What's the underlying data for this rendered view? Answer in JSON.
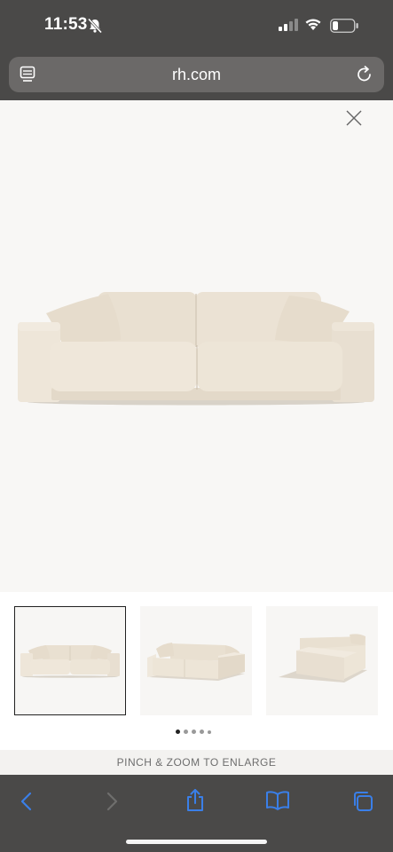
{
  "status_bar": {
    "time": "11:53"
  },
  "browser": {
    "url": "rh.com"
  },
  "gallery": {
    "thumbnails": [
      {
        "view": "front",
        "selected": true
      },
      {
        "view": "angled",
        "selected": false
      },
      {
        "view": "side",
        "selected": false
      }
    ],
    "dot_count": 5,
    "active_dot": 1,
    "hint": "PINCH & ZOOM TO ENLARGE"
  },
  "colors": {
    "chrome": "#4a4948",
    "url_bar": "#6b6968",
    "sofa": "#ede4d6",
    "toolbar_icons": "#3a7fe8"
  },
  "icons": {
    "status": [
      "bell-slash-icon",
      "cellular-signal-icon",
      "wifi-icon",
      "battery-icon"
    ],
    "url_bar": [
      "tabs-overview-icon",
      "reload-icon"
    ],
    "toolbar": [
      "back-icon",
      "forward-icon",
      "share-icon",
      "bookmarks-icon",
      "tabs-icon"
    ]
  }
}
